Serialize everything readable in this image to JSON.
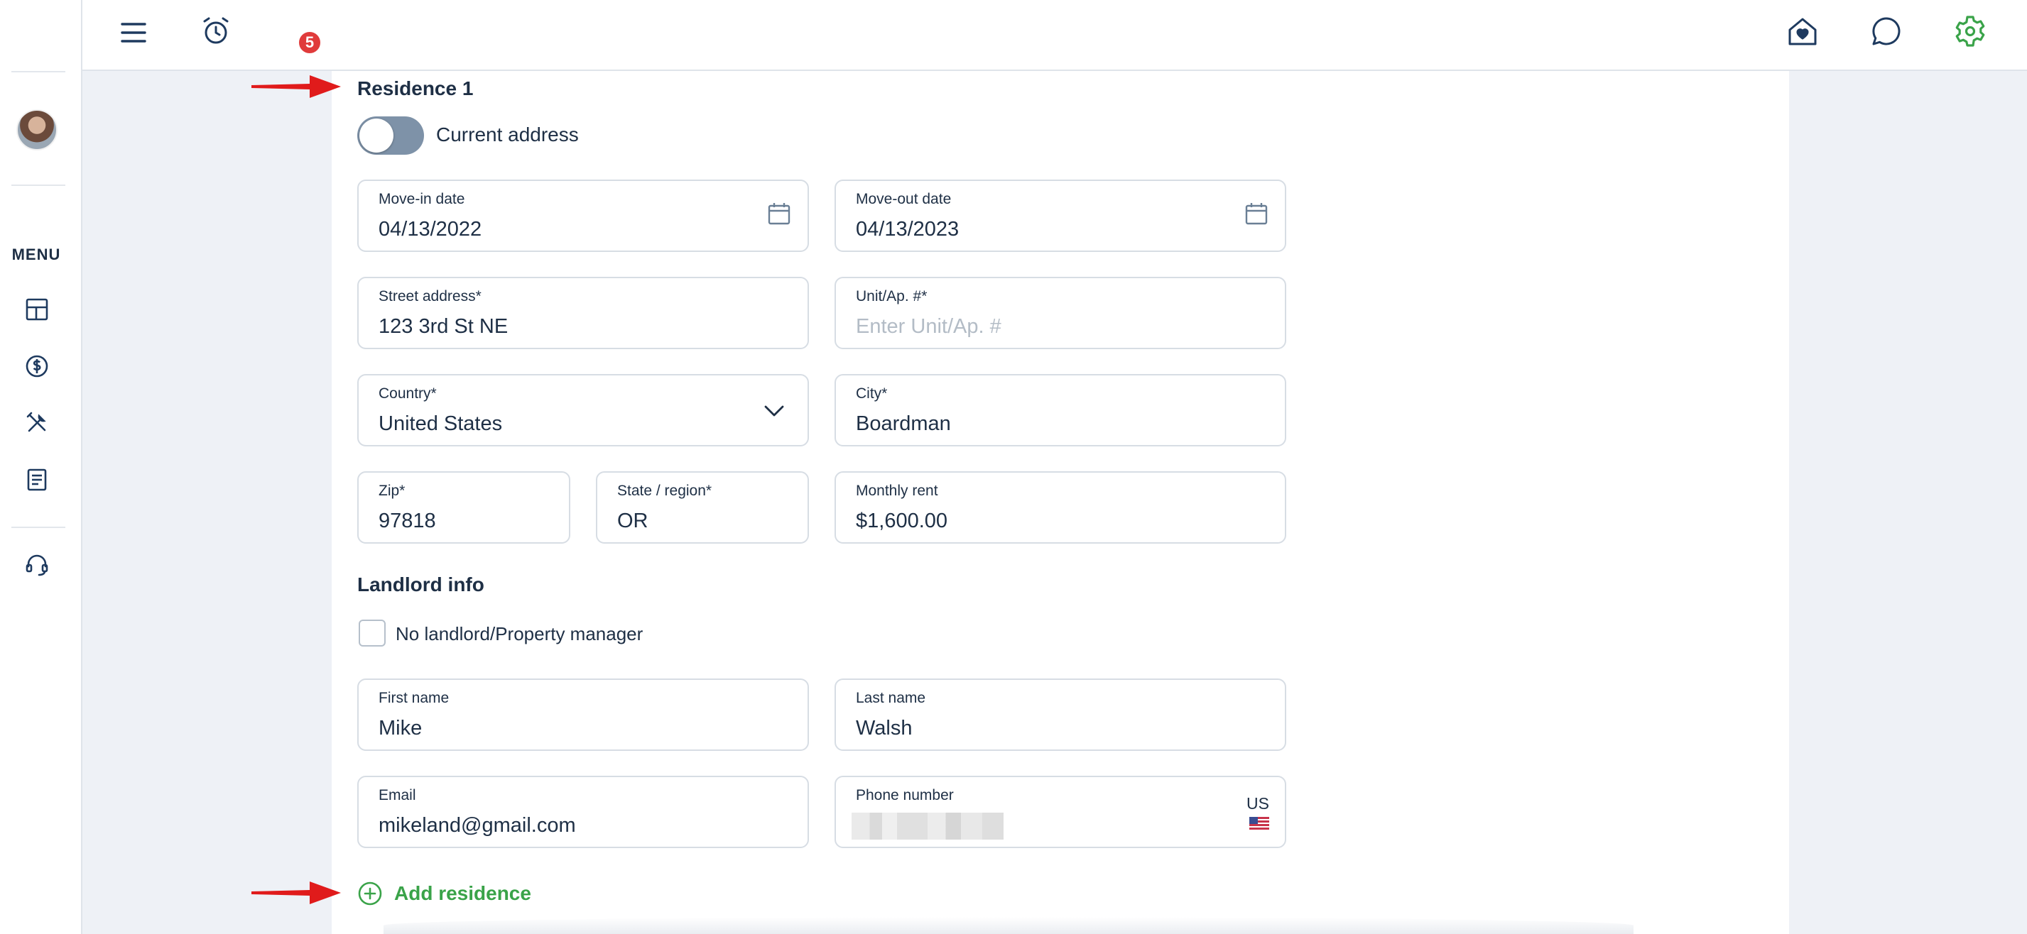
{
  "header": {
    "notification_count": "5",
    "icons": [
      "menu-icon",
      "alarm-clock-icon",
      "home-heart-icon",
      "chat-icon",
      "settings-icon"
    ],
    "settings_color": "#3aa349"
  },
  "sidebar": {
    "menu_label": "MENU",
    "items": [
      "dashboard-icon",
      "payments-icon",
      "maintenance-icon",
      "documents-icon",
      "support-icon"
    ]
  },
  "residence": {
    "title": "Residence 1",
    "current_address_label": "Current address",
    "current_address_on": false,
    "move_in": {
      "label": "Move-in date",
      "value": "04/13/2022"
    },
    "move_out": {
      "label": "Move-out date",
      "value": "04/13/2023"
    },
    "street": {
      "label": "Street address*",
      "value": "123 3rd St NE"
    },
    "unit": {
      "label": "Unit/Ap. #*",
      "placeholder": "Enter Unit/Ap. #"
    },
    "country": {
      "label": "Country*",
      "value": "United States"
    },
    "city": {
      "label": "City*",
      "value": "Boardman"
    },
    "zip": {
      "label": "Zip*",
      "value": "97818"
    },
    "state": {
      "label": "State / region*",
      "value": "OR"
    },
    "rent": {
      "label": "Monthly rent",
      "value": "$1,600.00"
    }
  },
  "landlord": {
    "title": "Landlord info",
    "no_landlord_label": "No landlord/Property manager",
    "no_landlord_checked": false,
    "first_name": {
      "label": "First name",
      "value": "Mike"
    },
    "last_name": {
      "label": "Last name",
      "value": "Walsh"
    },
    "email": {
      "label": "Email",
      "value": "mikeland@gmail.com"
    },
    "phone": {
      "label": "Phone number",
      "country_code": "US"
    }
  },
  "actions": {
    "add_residence_label": "Add residence",
    "accent_color": "#3aa349"
  },
  "annotation_color": "#e01b1b"
}
